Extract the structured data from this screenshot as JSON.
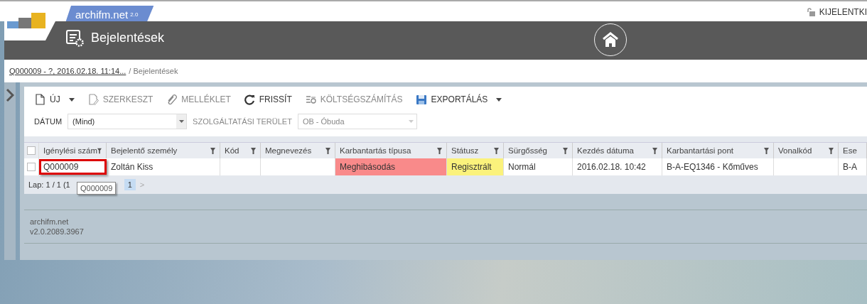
{
  "header": {
    "app_tab": "archifm.net",
    "app_version": "2.0",
    "logout": "KIJELENTKI",
    "page_title": "Bejelentések"
  },
  "breadcrumb": {
    "link": "Q000009 - ?, 2016.02.18. 11:14...",
    "current": "/ Bejelentések"
  },
  "toolbar": [
    {
      "label": "ÚJ",
      "kind": "new",
      "disabled": false,
      "dropdown": true
    },
    {
      "label": "SZERKESZT",
      "kind": "edit",
      "disabled": true,
      "dropdown": false
    },
    {
      "label": "MELLÉKLET",
      "kind": "attach",
      "disabled": true,
      "dropdown": false
    },
    {
      "label": "FRISSÍT",
      "kind": "refresh",
      "disabled": false,
      "dropdown": false
    },
    {
      "label": "KÖLTSÉGSZÁMÍTÁS",
      "kind": "cost",
      "disabled": true,
      "dropdown": false
    },
    {
      "label": "EXPORTÁLÁS",
      "kind": "export",
      "disabled": false,
      "dropdown": true
    }
  ],
  "filters": [
    {
      "label": "DÁTUM",
      "value": "(Mind)",
      "disabled": false
    },
    {
      "label": "SZOLGÁLTATÁSI TERÜLET",
      "value": "OB - Óbuda",
      "disabled": true
    }
  ],
  "table": {
    "select_all": false,
    "columns": [
      "Igénylési szám",
      "Bejelentő személy",
      "Kód",
      "Megnevezés",
      "Karbantartás típusa",
      "Státusz",
      "Sürgősség",
      "Kezdés dátuma",
      "Karbantartási pont",
      "Vonalkód",
      "Ese"
    ],
    "rows": [
      {
        "checked": false,
        "cells": [
          {
            "text": "Q000009",
            "marked": true
          },
          {
            "text": "Zoltán Kiss"
          },
          {},
          {},
          {
            "text": "Meghibásodás",
            "color": "#f98a8a"
          },
          {
            "text": "Regisztrált",
            "color": "#fbf27c"
          },
          {
            "text": "Normál"
          },
          {
            "text": "2016.02.18. 10:42"
          },
          {
            "text": "B-A-EQ1346 - Kőműves"
          },
          {},
          {
            "text": "B-A"
          }
        ]
      }
    ]
  },
  "pager": {
    "info": "Lap: 1 / 1 (1",
    "pages": [
      {
        "label": "1",
        "selected": true
      }
    ],
    "next": ">",
    "tooltip": "Q000009"
  },
  "footer": {
    "product": "archifm.net",
    "version": "v2.0.2089.3967"
  }
}
